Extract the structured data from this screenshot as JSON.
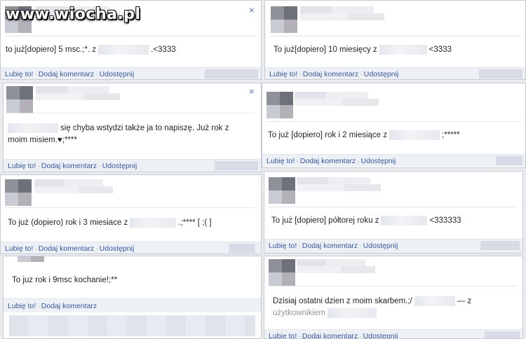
{
  "watermark": "www.wiocha.pl",
  "actions": {
    "like": "Lubię to!",
    "comment": "Dodaj komentarz",
    "share": "Udostępnij",
    "sep": "·"
  },
  "close_glyph": "×",
  "posts": {
    "p1": {
      "before": "to już[dopiero] 5 msc.;*. z",
      "after": ".<3333"
    },
    "p2": {
      "before": "To już[dopiero] 10 miesięcy z",
      "after": "<3333"
    },
    "p3": {
      "before": "się chyba wstydzi także ja to napiszę. Już rok z moim misiem.♥;****"
    },
    "p4": {
      "before": "To już [dopiero] rok i 2 miesiące z",
      "after": ";*****"
    },
    "p5": {
      "before": "To już (dopiero) rok i 3 miesiace z",
      "after": ".;**** [ ;( ]"
    },
    "p6": {
      "before": "To już [dopiero] półtorej roku z",
      "after": "<333333"
    },
    "p7": {
      "before": "To juz rok i 9msc kochanie!;**"
    },
    "p8": {
      "before": "Dzisiaj ostatni dzien z moim skarbem.;/",
      "after": "— z",
      "line2": "użytkownikiem"
    }
  }
}
